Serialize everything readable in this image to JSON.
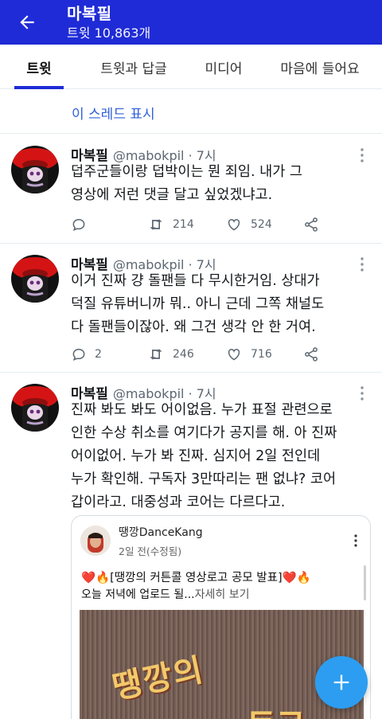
{
  "header": {
    "title": "마복필",
    "subtitle": "트윗 10,863개",
    "bg_color": "#1f2bd6"
  },
  "tabs": [
    {
      "label": "트윗",
      "active": true
    },
    {
      "label": "트윗과 답글",
      "active": false
    },
    {
      "label": "미디어",
      "active": false
    },
    {
      "label": "마음에 들어요",
      "active": false
    }
  ],
  "thread_link": "이 스레드 표시",
  "tweets": [
    {
      "name": "마복필",
      "handle": "@mabokpil · 7시",
      "text": "덥주군들이랑 덥박이는 뭔 죄임. 내가 그\n영상에 저런 댓글 달고 싶었겠냐고.",
      "replies": "",
      "retweets": "214",
      "likes": "524"
    },
    {
      "name": "마복필",
      "handle": "@mabokpil · 7시",
      "text": "이거 진짜 걍 돌팬들 다 무시한거임. 상대가\n덕질 유튜버니까 뭐.. 아니 근데 그쪽 채널도\n다 돌팬들이잖아. 왜 그건 생각 안 한 거여.",
      "replies": "2",
      "retweets": "246",
      "likes": "716"
    },
    {
      "name": "마복필",
      "handle": "@mabokpil · 7시",
      "text": "진짜 봐도 봐도 어이없음. 누가 표절 관련으로\n인한 수상 취소를 여기다가 공지를 해. 아 진짜\n어이없어. 누가 봐 진짜. 심지어 2일 전인데\n누가 확인해. 구독자 3만따리는 팬 없냐? 코어\n갑이라고. 대중성과 코어는 다르다고."
    }
  ],
  "quote": {
    "name": "땡깡DanceKang",
    "time": "2일 전(수정됨)",
    "line1": "❤️🔥[땡깡의 커튼콜 영상로고 공모 발표]❤️🔥",
    "line2": "오늘 저녁에 업로드 될...",
    "more": "자세히 보기",
    "image_text_1": "땡깡의",
    "image_text_2": "트코"
  }
}
